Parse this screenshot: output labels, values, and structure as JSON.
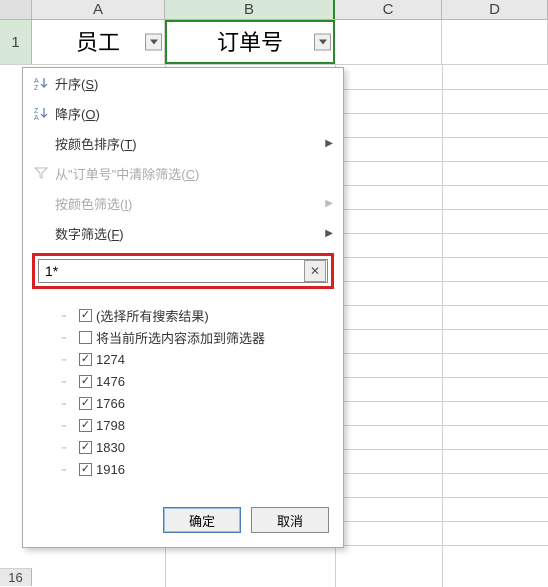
{
  "columns": {
    "a": "A",
    "b": "B",
    "c": "C",
    "d": "D"
  },
  "row1": {
    "num": "1",
    "a": "员工",
    "b": "订单号"
  },
  "row16": "16",
  "menu": {
    "sort_asc": "升序(S)",
    "sort_desc": "降序(O)",
    "sort_color": "按颜色排序(T)",
    "clear_filter": "从\"订单号\"中清除筛选(C)",
    "filter_color": "按颜色筛选(I)",
    "number_filter": "数字筛选(F)"
  },
  "search": {
    "value": "1*"
  },
  "checks": {
    "select_all": "(选择所有搜索结果)",
    "add_current": "将当前所选内容添加到筛选器",
    "items": [
      "1274",
      "1476",
      "1766",
      "1798",
      "1830",
      "1916"
    ]
  },
  "buttons": {
    "ok": "确定",
    "cancel": "取消"
  }
}
